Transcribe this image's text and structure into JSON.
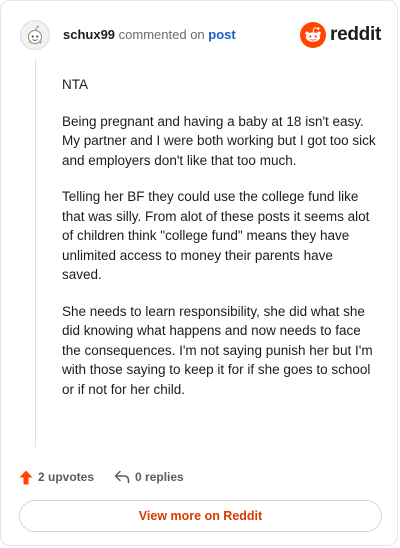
{
  "header": {
    "username": "schux99",
    "commented_text": "commented on",
    "post_link": "post",
    "brand": "reddit"
  },
  "comment": {
    "paragraphs": [
      "NTA",
      "Being pregnant and having a baby at 18 isn't easy. My partner and I were both working but I got too sick and employers don't like that too much.",
      "Telling her BF they could use the college fund like that was silly. From alot of these posts it seems alot of children think \"college fund\" means they have unlimited access to money their parents have saved.",
      "She needs to learn responsibility, she did what she did knowing what happens and now needs to face the consequences. I'm not saying punish her but I'm with those saying to keep it for if she goes to school or if not for her child."
    ]
  },
  "actions": {
    "upvotes": "2 upvotes",
    "replies": "0 replies"
  },
  "footer": {
    "view_more": "View more on Reddit"
  },
  "colors": {
    "brand_orange": "#ff4500",
    "link_blue": "#1a5ec4",
    "view_more_text": "#d93a00"
  },
  "icons": {
    "avatar": "snoo-avatar-icon",
    "brand": "reddit-logo-icon",
    "upvote": "upvote-arrow-icon",
    "reply": "reply-arrow-icon"
  }
}
